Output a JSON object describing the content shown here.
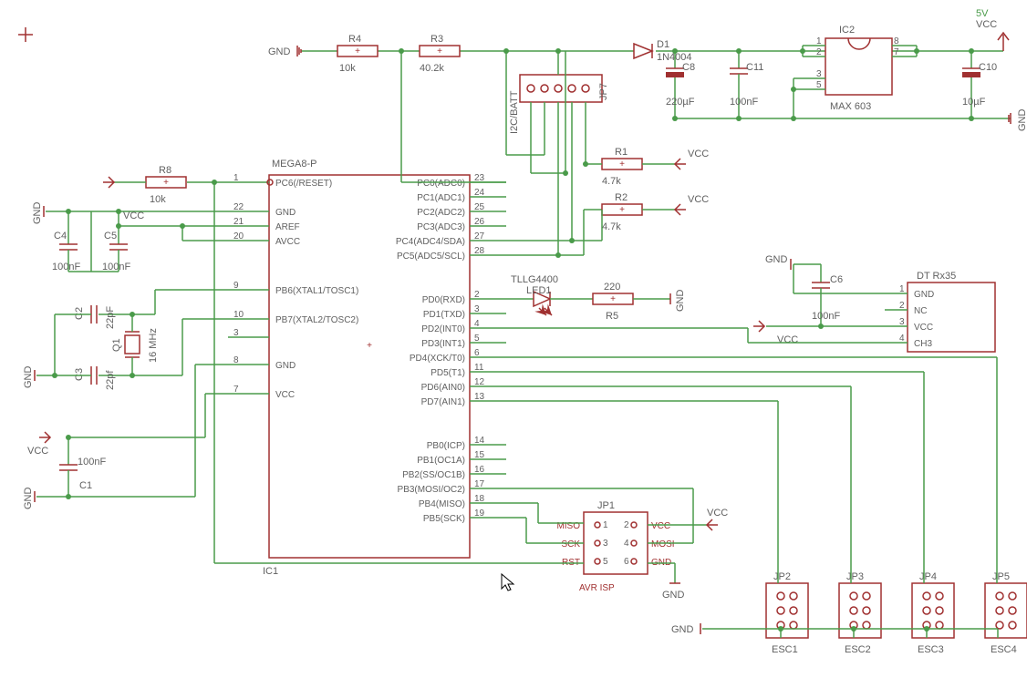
{
  "refs": {
    "r1": "R1",
    "r1v": "4.7k",
    "r2": "R2",
    "r2v": "4.7k",
    "r3": "R3",
    "r3v": "40.2k",
    "r4": "R4",
    "r4v": "10k",
    "r5": "R5",
    "r5v": "220",
    "r8": "R8",
    "r8v": "10k",
    "c1": "C1",
    "c1v": "100nF",
    "c2": "C2",
    "c2v": "22pF",
    "c3": "C3",
    "c3v": "22pf",
    "c4": "C4",
    "c4v": "100nF",
    "c5": "C5",
    "c5v": "100nF",
    "c6": "C6",
    "c6v": "100nF",
    "c8": "C8",
    "c8v": "220µF",
    "c10": "C10",
    "c10v": "10µF",
    "c11": "C11",
    "c11v": "100nF",
    "q1": "Q1",
    "q1v": "16 MHz",
    "d1": "D1",
    "d1v": "1N4004",
    "led1": "LED1",
    "led1v": "TLLG4400",
    "ic1": "IC1",
    "ic1type": "MEGA8-P",
    "ic2": "IC2",
    "ic2type": "MAX 603"
  },
  "netnames": {
    "gnd": "GND",
    "vcc": "VCC",
    "fiveV": "5V"
  },
  "connectors": {
    "jp1": "JP1",
    "jp1sub": "AVR ISP",
    "jp2": "JP2",
    "jp3": "JP3",
    "jp4": "JP4",
    "jp5": "JP5",
    "jp7": "JP7",
    "i2cbatt": "I2C/BATT",
    "esc1": "ESC1",
    "esc2": "ESC2",
    "esc3": "ESC3",
    "esc4": "ESC4",
    "dtRx": "DT Rx35"
  },
  "isp": {
    "miso": "MISO",
    "sck": "SCK",
    "rst": "RST",
    "mosi": "MOSI",
    "vcc": "VCC",
    "gnd": "GND",
    "p1": "1",
    "p2": "2",
    "p3": "3",
    "p4": "4",
    "p5": "5",
    "p6": "6"
  },
  "dtrx": {
    "p1": "1",
    "p2": "2",
    "p3": "3",
    "p4": "4",
    "gnd": "GND",
    "nc": "NC",
    "vcc": "VCC",
    "ch3": "CH3"
  },
  "ic": {
    "left": [
      {
        "n": "1",
        "l": "PC6(/RESET)"
      },
      {
        "n": "22",
        "l": "GND"
      },
      {
        "n": "21",
        "l": "AREF"
      },
      {
        "n": "20",
        "l": "AVCC"
      },
      {
        "n": "9",
        "l": "PB6(XTAL1/TOSC1)"
      },
      {
        "n": "10",
        "l": "PB7(XTAL2/TOSC2)"
      },
      {
        "n": "3",
        "l": ""
      },
      {
        "n": "8",
        "l": "GND"
      },
      {
        "n": "7",
        "l": "VCC"
      }
    ],
    "right": [
      {
        "n": "23",
        "l": "PC0(ADC0)"
      },
      {
        "n": "24",
        "l": "PC1(ADC1)"
      },
      {
        "n": "25",
        "l": "PC2(ADC2)"
      },
      {
        "n": "26",
        "l": "PC3(ADC3)"
      },
      {
        "n": "27",
        "l": "PC4(ADC4/SDA)"
      },
      {
        "n": "28",
        "l": "PC5(ADC5/SCL)"
      },
      {
        "n": "2",
        "l": "PD0(RXD)"
      },
      {
        "n": "3",
        "l": "PD1(TXD)"
      },
      {
        "n": "4",
        "l": "PD2(INT0)"
      },
      {
        "n": "5",
        "l": "PD3(INT1)"
      },
      {
        "n": "6",
        "l": "PD4(XCK/T0)"
      },
      {
        "n": "11",
        "l": "PD5(T1)"
      },
      {
        "n": "12",
        "l": "PD6(AIN0)"
      },
      {
        "n": "13",
        "l": "PD7(AIN1)"
      },
      {
        "n": "14",
        "l": "PB0(ICP)"
      },
      {
        "n": "15",
        "l": "PB1(OC1A)"
      },
      {
        "n": "16",
        "l": "PB2(SS/OC1B)"
      },
      {
        "n": "17",
        "l": "PB3(MOSI/OC2)"
      },
      {
        "n": "18",
        "l": "PB4(MISO)"
      },
      {
        "n": "19",
        "l": "PB5(SCK)"
      }
    ]
  },
  "ic2pins": {
    "p1": "1",
    "p2": "2",
    "p3": "3",
    "p5": "5",
    "p7": "7",
    "p8": "8"
  }
}
